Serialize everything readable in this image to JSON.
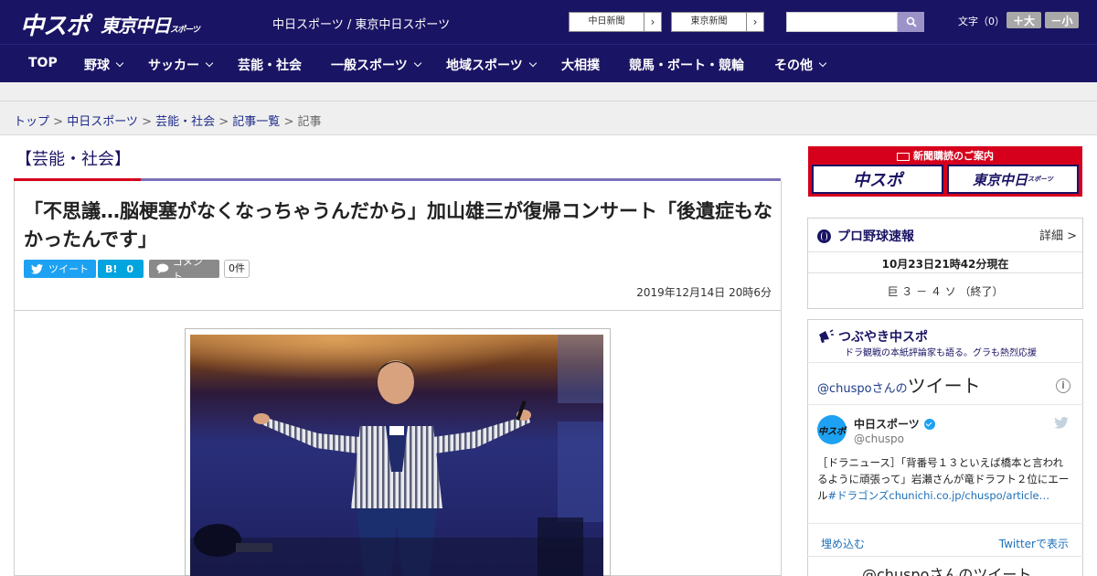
{
  "header": {
    "logo_main": "中スポ",
    "logo_tokyo": "東京中日",
    "logo_tokyo_sub": "スポーツ",
    "site_link_chunichi": "中日スポーツ",
    "site_link_sep": " / ",
    "site_link_tokyo": "東京中日スポーツ",
    "paper_btn_1": "中日新聞",
    "paper_btn_2": "東京新聞",
    "arrow": "›",
    "search_placeholder": "",
    "font_size_label": "文字（0）",
    "font_plus": "＋大",
    "font_minus": "－小"
  },
  "nav": {
    "items": [
      {
        "label": "TOP",
        "dropdown": false
      },
      {
        "label": "野球",
        "dropdown": true
      },
      {
        "label": "サッカー",
        "dropdown": true
      },
      {
        "label": "芸能・社会",
        "dropdown": false
      },
      {
        "label": "一般スポーツ",
        "dropdown": true
      },
      {
        "label": "地域スポーツ",
        "dropdown": true
      },
      {
        "label": "大相撲",
        "dropdown": false
      },
      {
        "label": "競馬・ボート・競輪",
        "dropdown": false
      },
      {
        "label": "その他",
        "dropdown": true
      }
    ]
  },
  "breadcrumb": {
    "items": [
      "トップ",
      "中日スポーツ",
      "芸能・社会",
      "記事一覧"
    ],
    "current": "記事",
    "separator": " > "
  },
  "article": {
    "category": "【芸能・社会】",
    "title": "「不思議…脳梗塞がなくなっちゃうんだから」加山雄三が復帰コンサート「後遺症もなかったんです」",
    "tweet_label": "ツイート",
    "hatena_label": "B!",
    "hatena_count": "0",
    "comment_label": "コメント",
    "comment_count": "0件",
    "date": "2019年12月14日 20時6分"
  },
  "sidebar": {
    "subscription": {
      "title": "新聞購読のご案内",
      "btn_1": "中スポ",
      "btn_2": "東京中日",
      "btn_2_sub": "スポーツ"
    },
    "baseball": {
      "title": "プロ野球速報",
      "more": "詳細 >",
      "timestamp": "10月23日21時42分現在",
      "score": "巨 ３ － ４ ソ （終了）"
    },
    "tsubuyaki": {
      "title": "つぶやき中スポ",
      "subtitle": "ドラ観戦の本紙評論家も語る。グラも熱烈応援"
    },
    "twitter": {
      "header_handle": "@chuspoさんの",
      "header_suffix": "ツイート",
      "account_name": "中日スポーツ",
      "account_handle": "@chuspo",
      "avatar_text": "中スポ",
      "tweet_text": "［ドラニュース］「背番号１３といえば橋本と言われるように頑張って」岩瀬さんが竜ドラフト２位にエール",
      "tweet_hashtag": "#ドラゴンズ",
      "tweet_link": "chunichi.co.jp/chuspo/article…",
      "embed_label": "埋め込む",
      "view_label": "Twitterで表示",
      "footer_text": "@chuspoさんのツイート"
    }
  },
  "colors": {
    "brand_navy": "#1a1464",
    "brand_red": "#d6001c",
    "accent_purple": "#7a72b8",
    "twitter_blue": "#1da1f2",
    "hatena_blue": "#00a4de",
    "link_blue": "#1d2b8a"
  }
}
